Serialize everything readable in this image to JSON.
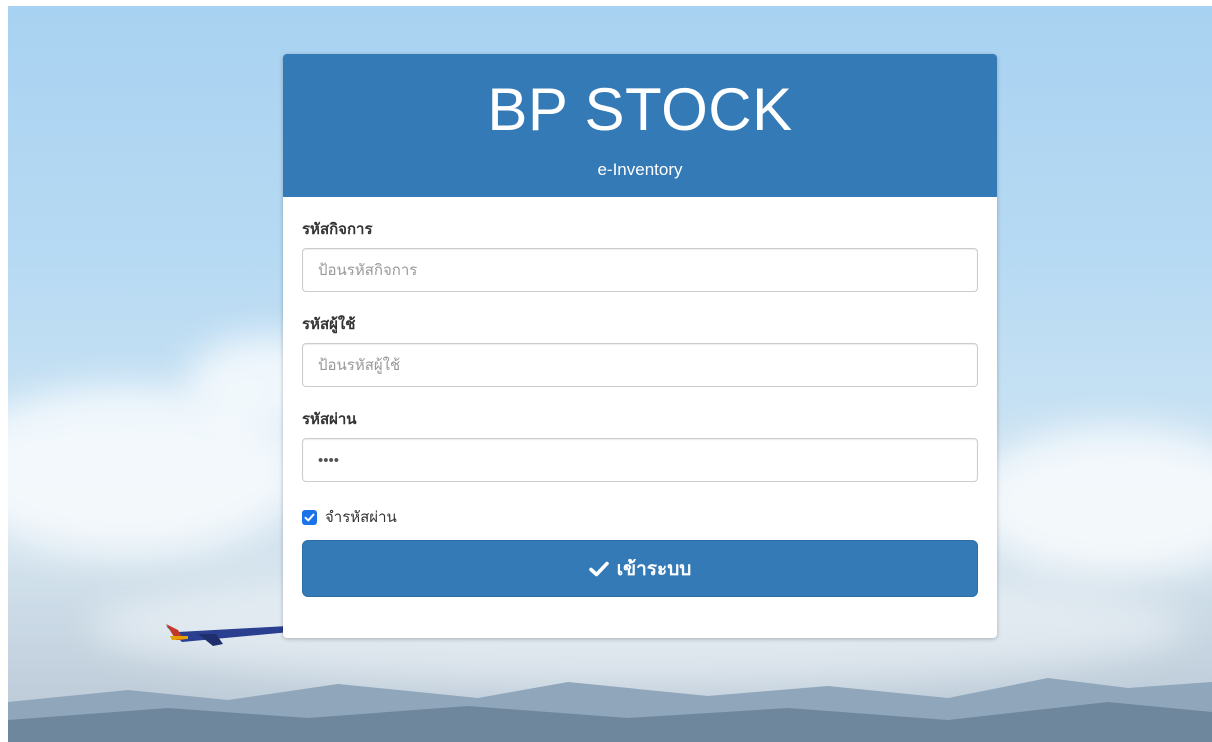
{
  "brand": {
    "title": "BP STOCK",
    "subtitle": "e-Inventory"
  },
  "form": {
    "business_code": {
      "label": "รหัสกิจการ",
      "placeholder": "ป้อนรหัสกิจการ",
      "value": ""
    },
    "username": {
      "label": "รหัสผู้ใช้",
      "placeholder": "ป้อนรหัสผู้ใช้",
      "value": ""
    },
    "password": {
      "label": "รหัสผ่าน",
      "value": "1234"
    },
    "remember": {
      "label": "จำรหัสผ่าน",
      "checked": true
    },
    "submit_label": "เข้าระบบ"
  },
  "icons": {
    "submit": "check-icon",
    "remember": "checkbox-checked-icon"
  },
  "colors": {
    "primary": "#337ab7",
    "checkbox": "#1a73e8"
  }
}
